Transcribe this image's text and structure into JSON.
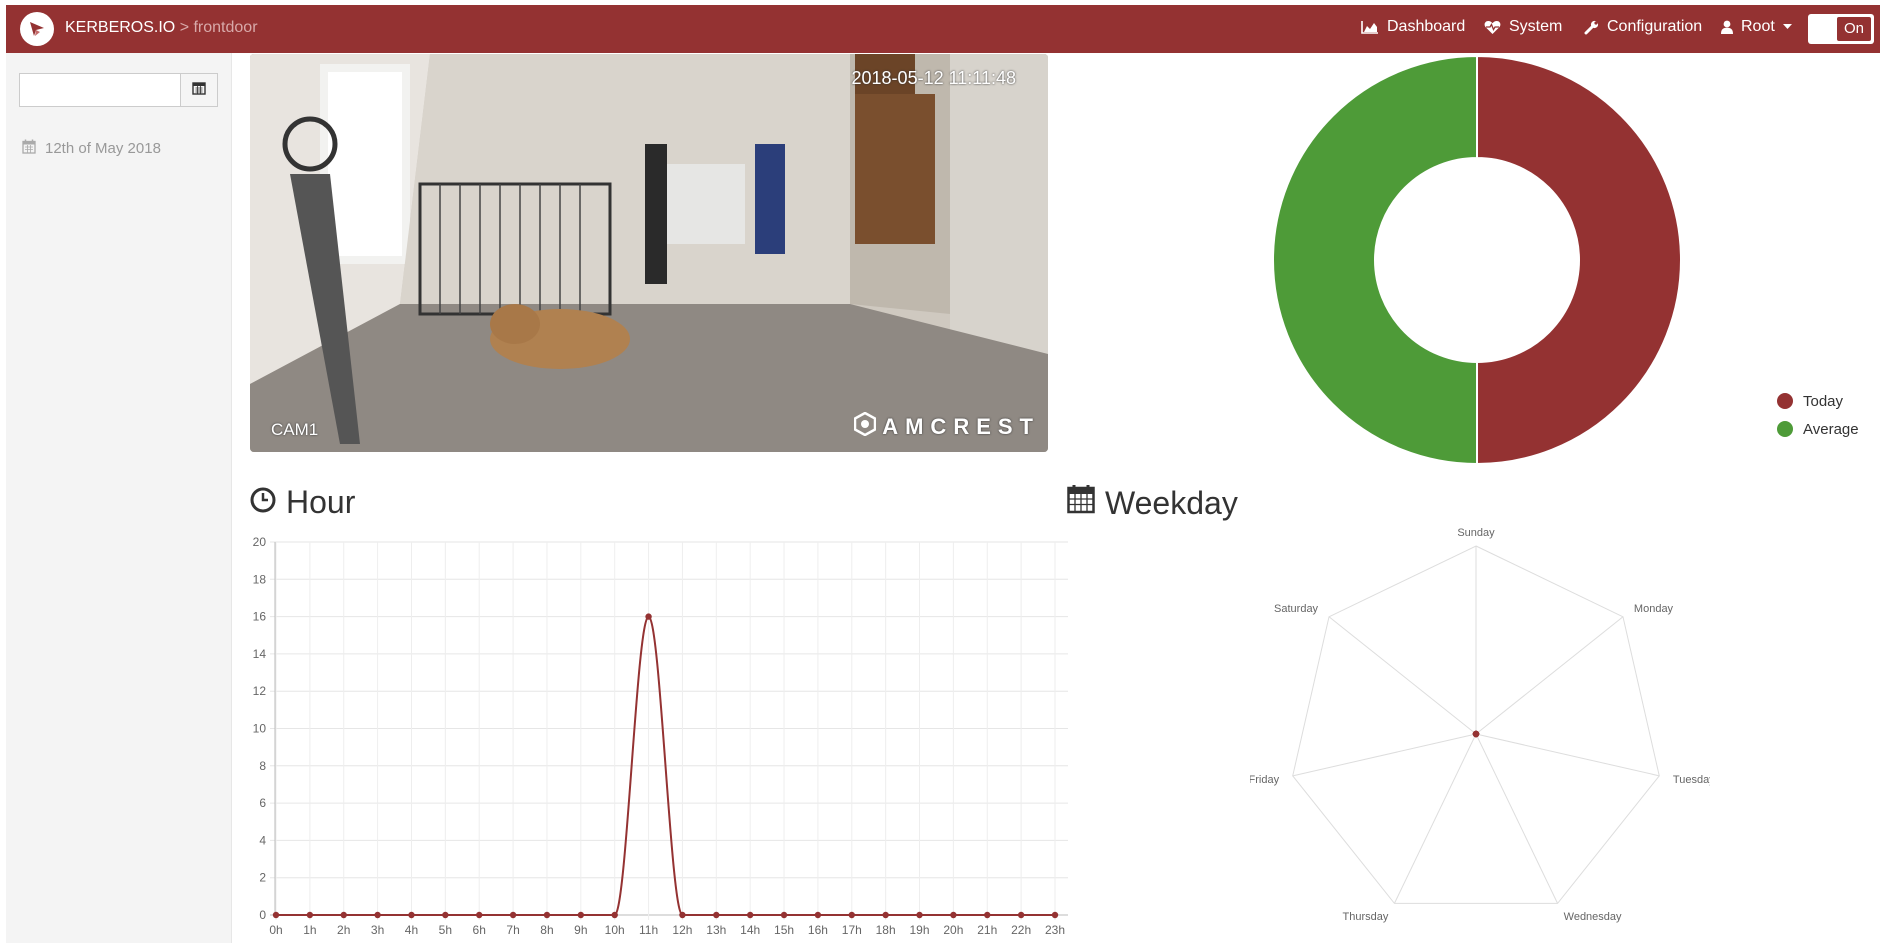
{
  "navbar": {
    "brand": "KERBEROS.IO",
    "separator": " > ",
    "camera_name": "frontdoor",
    "items": [
      {
        "label": "Dashboard",
        "icon": "area-chart-icon"
      },
      {
        "label": "System",
        "icon": "heartbeat-icon"
      },
      {
        "label": "Configuration",
        "icon": "wrench-icon"
      },
      {
        "label": "Root",
        "icon": "user-icon"
      }
    ],
    "toggle_label": "On"
  },
  "sidebar": {
    "date_input_value": "",
    "date_label": "12th of May 2018"
  },
  "camera": {
    "timestamp": "2018-05-12 11:11:48",
    "name": "CAM1",
    "brand": "AMCREST"
  },
  "sections": {
    "hour_title": "Hour",
    "weekday_title": "Weekday"
  },
  "colors": {
    "accent": "#943232",
    "today": "#943232",
    "average": "#4e9b38"
  },
  "chart_data": [
    {
      "type": "pie",
      "variant": "doughnut",
      "labels": [
        "Today",
        "Average"
      ],
      "values": [
        1,
        1
      ],
      "legend": "right"
    },
    {
      "type": "line",
      "x": [
        "0h",
        "1h",
        "2h",
        "3h",
        "4h",
        "5h",
        "6h",
        "7h",
        "8h",
        "9h",
        "10h",
        "11h",
        "12h",
        "13h",
        "14h",
        "15h",
        "16h",
        "17h",
        "18h",
        "19h",
        "20h",
        "21h",
        "22h",
        "23h"
      ],
      "values": [
        0,
        0,
        0,
        0,
        0,
        0,
        0,
        0,
        0,
        0,
        0,
        16,
        0,
        0,
        0,
        0,
        0,
        0,
        0,
        0,
        0,
        0,
        0,
        0
      ],
      "ylim": [
        0,
        20
      ],
      "yticks": [
        0,
        2,
        4,
        6,
        8,
        10,
        12,
        14,
        16,
        18,
        20
      ],
      "grid": true
    },
    {
      "type": "radar",
      "categories": [
        "Sunday",
        "Monday",
        "Tuesday",
        "Wednesday",
        "Thursday",
        "Friday",
        "Saturday"
      ],
      "values": [
        0,
        0,
        0,
        0,
        0,
        0,
        0
      ]
    }
  ]
}
